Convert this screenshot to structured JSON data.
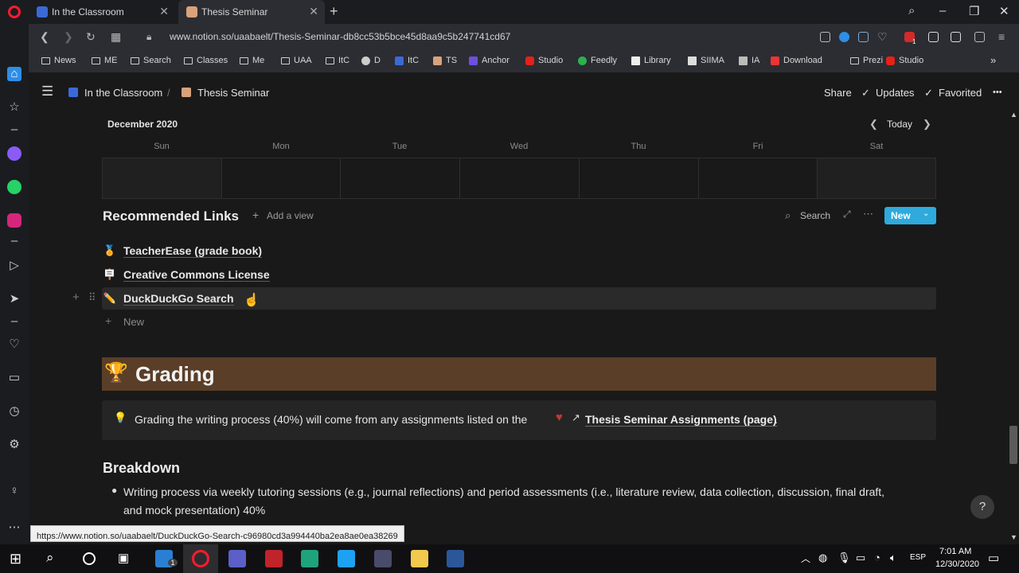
{
  "browser": {
    "tabs": [
      {
        "title": "In the Classroom"
      },
      {
        "title": "Thesis Seminar"
      }
    ],
    "url": "www.notion.so/uaabaelt/Thesis-Seminar-db8cc53b5bce45d8aa9c5b247741cd67",
    "bookmarks": [
      "News",
      "ME",
      "Search",
      "Classes",
      "Me",
      "UAA",
      "ItC",
      "D",
      "ItC",
      "TS",
      "Anchor",
      "Studio",
      "Feedly",
      "Library",
      "SIIMA",
      "IA",
      "Download",
      "Prezi",
      "Studio"
    ],
    "status_url": "https://www.notion.so/uaabaelt/DuckDuckGo-Search-c96980cd3a994440ba2ea8ae0ea38269",
    "badge_count": "1"
  },
  "notion": {
    "breadcrumb": [
      "In the Classroom",
      "Thesis Seminar"
    ],
    "breadcrumb_sep": "/",
    "topbar": {
      "share": "Share",
      "updates": "Updates",
      "favorited": "Favorited",
      "more": "•••"
    },
    "calendar": {
      "month": "December 2020",
      "today": "Today",
      "days": [
        "Sun",
        "Mon",
        "Tue",
        "Wed",
        "Thu",
        "Fri",
        "Sat"
      ]
    },
    "links_db": {
      "title": "Recommended Links",
      "add_view": "Add a view",
      "search": "Search",
      "new_button": "New",
      "rows": [
        {
          "emoji": "🏅",
          "label": "TeacherEase (grade book)"
        },
        {
          "emoji": "🪧",
          "label": "Creative Commons License"
        },
        {
          "emoji": "✏️",
          "label": "DuckDuckGo Search"
        }
      ],
      "new_row": "New"
    },
    "grading": {
      "emoji": "🏆",
      "heading": "Grading",
      "callout_emoji": "💡",
      "callout_text": "Grading the writing process (40%) will come from any assignments listed on the",
      "callout_link": "Thesis Seminar Assignments (page)",
      "callout_end": "."
    },
    "breakdown": {
      "heading": "Breakdown",
      "items": [
        {
          "line1": "Writing process via weekly tutoring sessions (e.g., journal reflections) and period assessments (i.e., literature review, data collection, discussion, final draft,",
          "line2": "and mock presentation) 40%"
        }
      ]
    },
    "help": "?"
  },
  "taskbar": {
    "language": "ESP",
    "time": "7:01 AM",
    "date": "12/30/2020",
    "mail_badge": "1"
  },
  "colors": {
    "accent_blue": "#2eaadc",
    "grading_band": "#5a3e28",
    "callout_bg": "#252525",
    "opera_red": "#ff1b2d"
  }
}
